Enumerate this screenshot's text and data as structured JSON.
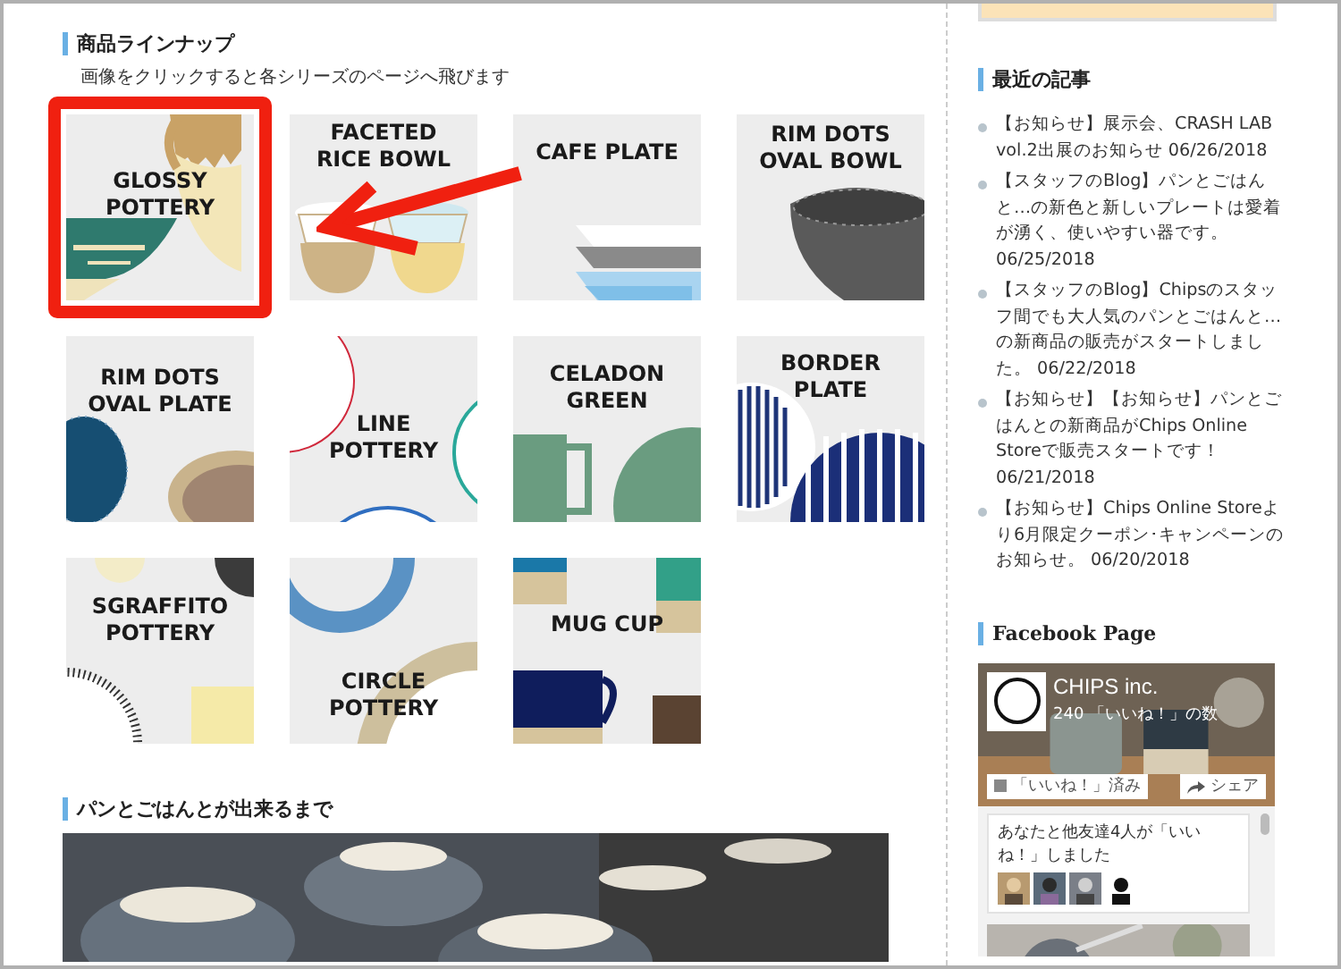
{
  "lineup": {
    "heading": "商品ラインナップ",
    "subtitle": "画像をクリックすると各シリーズのページへ飛びます",
    "tiles": [
      {
        "label": "GLOSSY POTTERY",
        "highlighted": true
      },
      {
        "label": "FACETED RICE BOWL",
        "highlighted": false
      },
      {
        "label": "CAFE PLATE",
        "highlighted": false
      },
      {
        "label": "RIM DOTS OVAL BOWL",
        "highlighted": false
      },
      {
        "label": "RIM DOTS OVAL PLATE",
        "highlighted": false
      },
      {
        "label": "LINE POTTERY",
        "highlighted": false
      },
      {
        "label": "CELADON GREEN",
        "highlighted": false
      },
      {
        "label": "BORDER PLATE",
        "highlighted": false
      },
      {
        "label": "SGRAFFITO POTTERY",
        "highlighted": false
      },
      {
        "label": "CIRCLE POTTERY",
        "highlighted": false
      },
      {
        "label": "MUG CUP",
        "highlighted": false
      }
    ]
  },
  "making": {
    "heading": "パンとごはんとが出来るまで"
  },
  "sidebar": {
    "recent_heading": "最近の記事",
    "posts": [
      {
        "title": "【お知らせ】展示会、CRASH LAB vol.2出展のお知らせ",
        "date": "06/26/2018"
      },
      {
        "title": "【スタッフのBlog】パンとごはんと…の新色と新しいプレートは愛着が湧く、使いやすい器です。",
        "date": "06/25/2018"
      },
      {
        "title": "【スタッフのBlog】Chipsのスタッフ間でも大人気のパンとごはんと…の新商品の販売がスタートしました。",
        "date": "06/22/2018"
      },
      {
        "title": "【お知らせ】【お知らせ】パンとごはんとの新商品がChips Online Storeで販売スタートです！",
        "date": "06/21/2018"
      },
      {
        "title": "【お知らせ】Chips Online Storeより6月限定クーポン･キャンペーンのお知らせ。",
        "date": "06/20/2018"
      }
    ],
    "facebook_heading": "Facebook Page",
    "facebook": {
      "page_name": "CHIPS inc.",
      "likes": "240 「いいね！」の数",
      "like_button": "「いいね！」済み",
      "share_button": "シェア",
      "friends_text": "あなたと他友達4人が「いいね！」しました"
    }
  }
}
